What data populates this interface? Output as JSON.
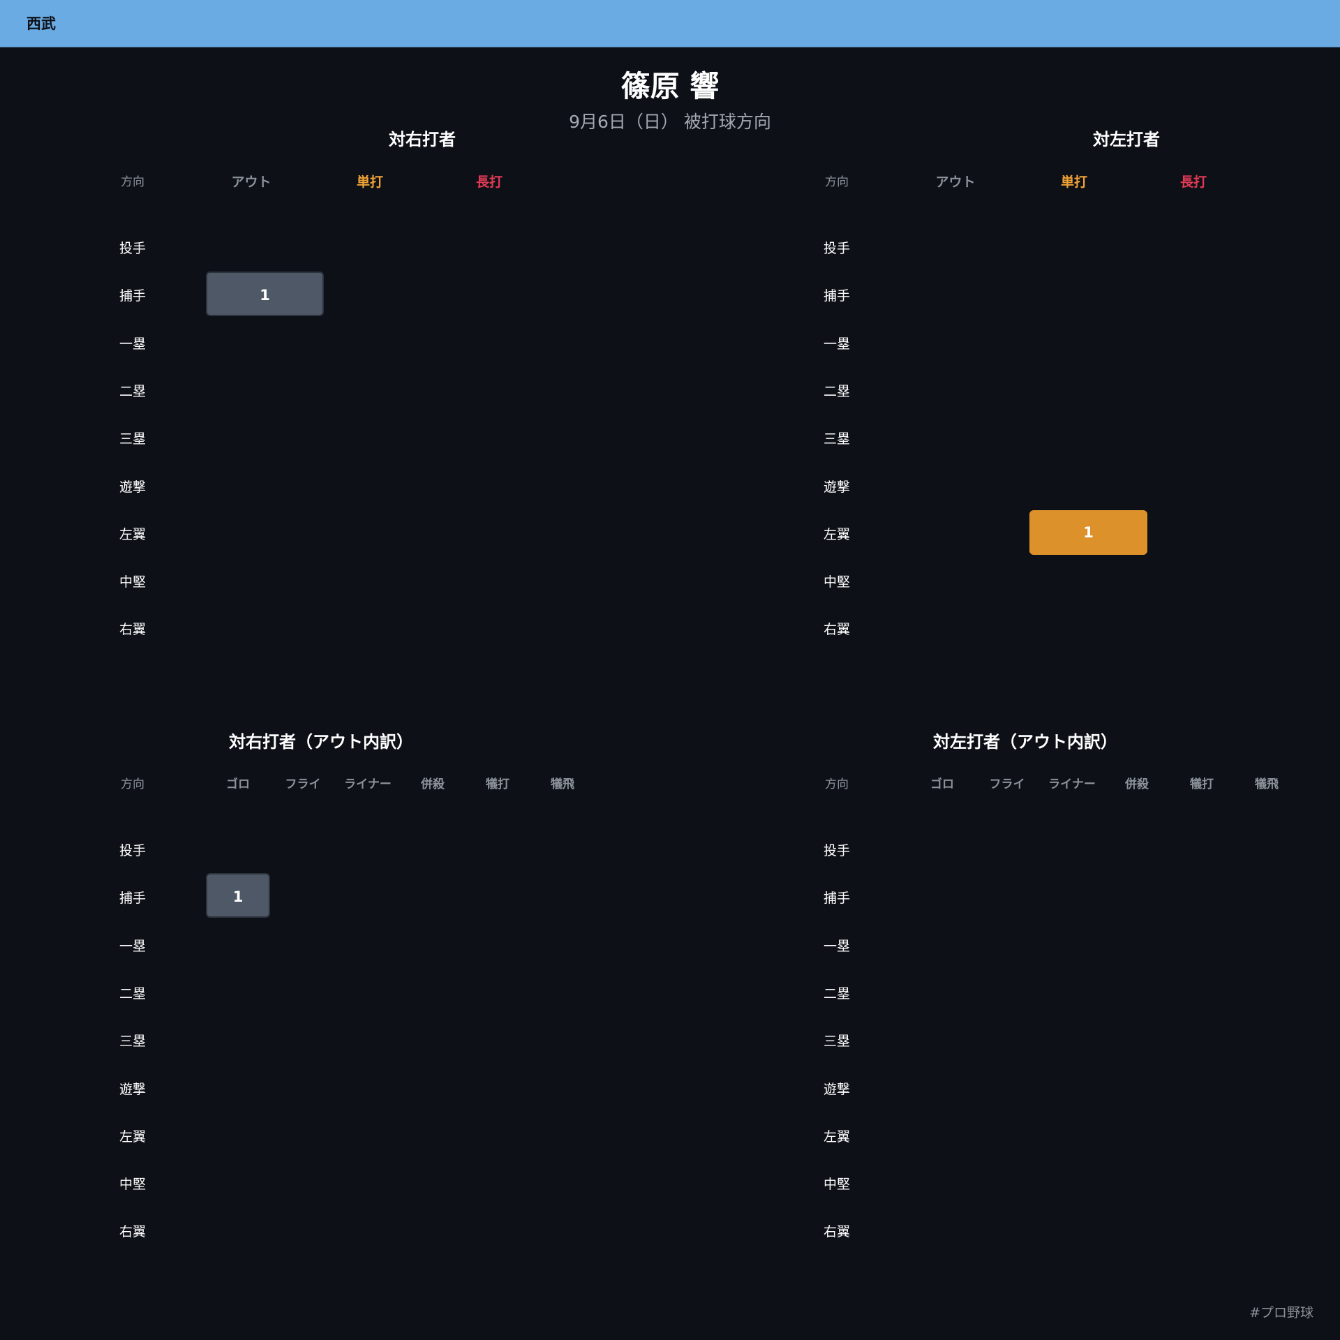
{
  "header": {
    "team": "西武"
  },
  "player_name": "篠原 響",
  "subtitle": "9月6日（日） 被打球方向",
  "row_labels": [
    "投手",
    "捕手",
    "一塁",
    "二塁",
    "三塁",
    "遊撃",
    "左翼",
    "中堅",
    "右翼"
  ],
  "panels": {
    "vs_right": {
      "title": "対右打者",
      "direction_header": "方向",
      "columns": [
        "アウト",
        "単打",
        "長打"
      ],
      "cells": [
        {
          "row": "捕手",
          "column": "アウト",
          "value": "1"
        }
      ]
    },
    "vs_left": {
      "title": "対左打者",
      "direction_header": "方向",
      "columns": [
        "アウト",
        "単打",
        "長打"
      ],
      "cells": [
        {
          "row": "左翼",
          "column": "単打",
          "value": "1"
        }
      ]
    },
    "vs_right_outs": {
      "title": "対右打者（アウト内訳）",
      "direction_header": "方向",
      "columns": [
        "ゴロ",
        "フライ",
        "ライナー",
        "併殺",
        "犠打",
        "犠飛"
      ],
      "cells": [
        {
          "row": "捕手",
          "column": "ゴロ",
          "value": "1"
        }
      ]
    },
    "vs_left_outs": {
      "title": "対左打者（アウト内訳）",
      "direction_header": "方向",
      "columns": [
        "ゴロ",
        "フライ",
        "ライナー",
        "併殺",
        "犠打",
        "犠飛"
      ],
      "cells": []
    }
  },
  "colors": {
    "header_bar": "#6aabe4",
    "background": "#0d1017",
    "out": "#4e5866",
    "single": "#dc912b",
    "long": "#e23a55"
  },
  "footer": {
    "hashtag": "#プロ野球"
  }
}
